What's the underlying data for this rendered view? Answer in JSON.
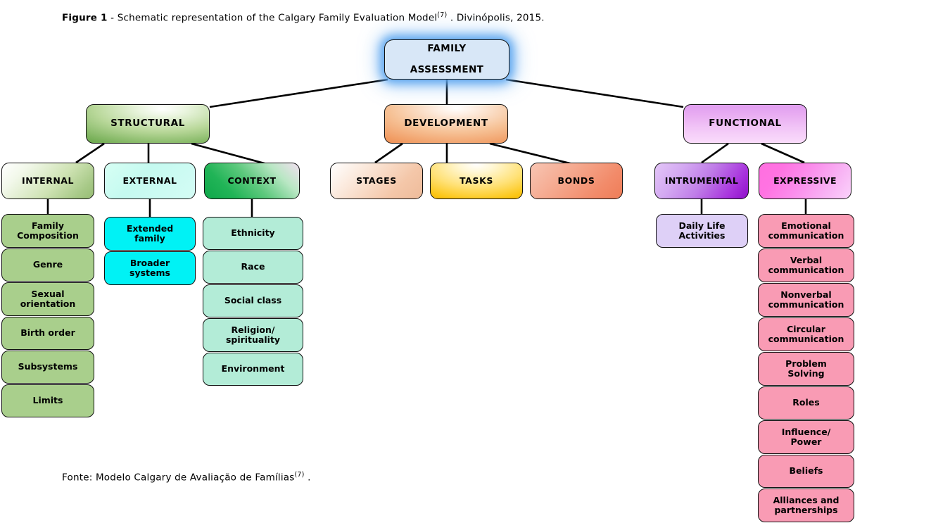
{
  "figure": {
    "label": "Figure 1",
    "caption": " - Schematic representation  of the Calgary Family  Evaluation Model",
    "caption_ref": "(7)",
    "caption_tail": " . Divinópolis,  2015.",
    "source": "Fonte: Modelo Calgary  de Avaliação de Famílias",
    "source_ref": "(7)",
    "source_tail": " ."
  },
  "root": {
    "label": "FAMILY\nASSESSMENT",
    "line1": "FAMILY",
    "line2": "ASSESSMENT",
    "color": "#d8e7f7"
  },
  "branches": {
    "structural": {
      "label": "STRUCTURAL",
      "color": "#74ae55"
    },
    "development": {
      "label": "DEVELOPMENT",
      "color": "#ef9155"
    },
    "functional": {
      "label": "FUNCTIONAL",
      "color": "#e09df0"
    }
  },
  "subbranches": {
    "internal": {
      "label": "INTERNAL",
      "color": "#a7c987"
    },
    "external": {
      "label": "EXTERNAL",
      "color": "#c5faf0"
    },
    "context": {
      "label": "CONTEXT",
      "color": "#21b457"
    },
    "stages": {
      "label": "STAGES",
      "color": "#f4c7a9"
    },
    "tasks": {
      "label": "TASKS",
      "color": "#ffe176"
    },
    "bonds": {
      "label": "BONDS",
      "color": "#f28b6a"
    },
    "intrumental": {
      "label": "INTRUMENTAL",
      "color": "#a832dd"
    },
    "expressive": {
      "label": "EXPRESSIVE",
      "color": "#fb8eec"
    }
  },
  "leaves": {
    "internal": {
      "color": "#a9cf8c",
      "items": [
        {
          "line1": "Family",
          "line2": "Composition"
        },
        {
          "line1": "Genre",
          "line2": ""
        },
        {
          "line1": "Sexual",
          "line2": "orientation"
        },
        {
          "line1": "Birth order",
          "line2": ""
        },
        {
          "line1": "Subsystems",
          "line2": ""
        },
        {
          "line1": "Limits",
          "line2": ""
        }
      ]
    },
    "external": {
      "color": "#00f2f5",
      "items": [
        {
          "line1": "Extended",
          "line2": "family"
        },
        {
          "line1": "Broader",
          "line2": "systems"
        }
      ]
    },
    "context": {
      "color": "#b3ecd7",
      "items": [
        {
          "line1": "Ethnicity",
          "line2": ""
        },
        {
          "line1": "Race",
          "line2": ""
        },
        {
          "line1": "Social class",
          "line2": ""
        },
        {
          "line1": "Religion/",
          "line2": "spirituality"
        },
        {
          "line1": "Environment",
          "line2": ""
        }
      ]
    },
    "intrumental": {
      "color": "#ded0f7",
      "items": [
        {
          "line1": "Daily Life",
          "line2": "Activities"
        }
      ]
    },
    "expressive": {
      "color": "#f99bb4",
      "items": [
        {
          "line1": "Emotional",
          "line2": "communication"
        },
        {
          "line1": "Verbal",
          "line2": "communication"
        },
        {
          "line1": "Nonverbal",
          "line2": "communication"
        },
        {
          "line1": "Circular",
          "line2": "communication"
        },
        {
          "line1": "Problem",
          "line2": "Solving"
        },
        {
          "line1": "Roles",
          "line2": ""
        },
        {
          "line1": "Influence/",
          "line2": "Power"
        },
        {
          "line1": "Beliefs",
          "line2": ""
        },
        {
          "line1": "Alliances and",
          "line2": "partnerships"
        }
      ]
    }
  },
  "connectors": [
    {
      "from": "family-assessment",
      "to": "structural"
    },
    {
      "from": "family-assessment",
      "to": "development"
    },
    {
      "from": "family-assessment",
      "to": "functional"
    },
    {
      "from": "structural",
      "to": "internal"
    },
    {
      "from": "structural",
      "to": "external"
    },
    {
      "from": "structural",
      "to": "context"
    },
    {
      "from": "development",
      "to": "stages"
    },
    {
      "from": "development",
      "to": "tasks"
    },
    {
      "from": "development",
      "to": "bonds"
    },
    {
      "from": "functional",
      "to": "intrumental"
    },
    {
      "from": "functional",
      "to": "expressive"
    },
    {
      "from": "internal",
      "to": "col-internal"
    },
    {
      "from": "external",
      "to": "col-external"
    },
    {
      "from": "context",
      "to": "col-context"
    },
    {
      "from": "intrumental",
      "to": "col-intrumental"
    },
    {
      "from": "expressive",
      "to": "col-expressive"
    }
  ]
}
